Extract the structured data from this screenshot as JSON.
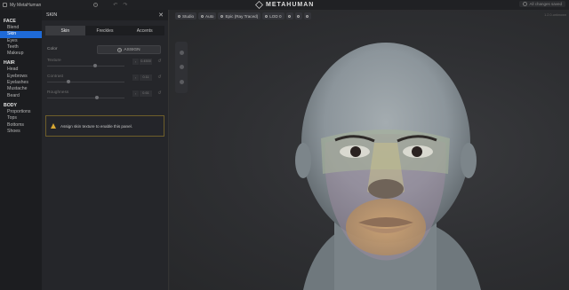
{
  "topbar": {
    "project_name": "My MetaHuman",
    "brand": "METAHUMAN",
    "status": "All changes saved"
  },
  "nav": {
    "groups": [
      {
        "label": "FACE",
        "items": [
          "Blend",
          "Skin",
          "Eyes",
          "Teeth",
          "Makeup"
        ]
      },
      {
        "label": "HAIR",
        "items": [
          "Head",
          "Eyebrows",
          "Eyelashes",
          "Mustache",
          "Beard"
        ]
      },
      {
        "label": "BODY",
        "items": [
          "Proportions",
          "Tops",
          "Bottoms",
          "Shoes"
        ]
      }
    ],
    "active_item": "Skin"
  },
  "panel": {
    "title": "SKIN",
    "tabs": [
      "Skin",
      "Freckles",
      "Accents"
    ],
    "active_tab": "Skin",
    "color_label": "Color",
    "assign_label": "ASSIGN",
    "sliders": [
      {
        "label": "Texture",
        "value": "0.4500",
        "fraction": 0.6
      },
      {
        "label": "Contrast",
        "value": "0.11",
        "fraction": 0.1
      },
      {
        "label": "Roughness",
        "value": "0.61",
        "fraction": 0.6
      }
    ],
    "warning": "Assign skin texture to enable this panel.",
    "warning_color": "#d8a733"
  },
  "viewport": {
    "toolbar": [
      "Studio",
      "Auto",
      "Epic (Ray Traced)",
      "LOD 0"
    ],
    "version": "1.2.0-unknown"
  },
  "colors": {
    "accent": "#1e6ad8"
  }
}
